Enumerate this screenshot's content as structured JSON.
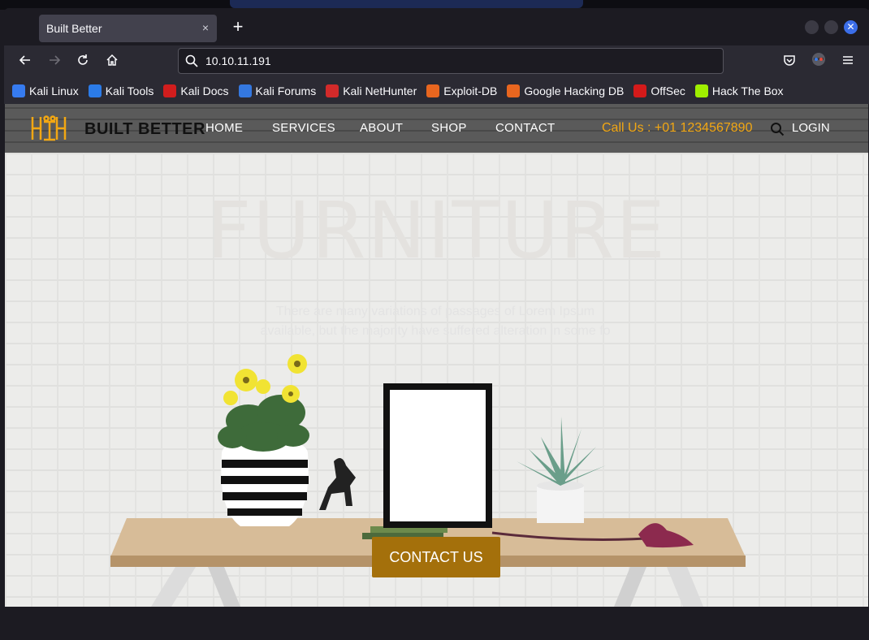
{
  "browser": {
    "tab_title": "Built Better",
    "url": "10.10.11.191",
    "close_tab_glyph": "×",
    "new_tab_glyph": "+"
  },
  "bookmarks": [
    {
      "label": "Kali Linux",
      "icon": "kali-dragon-icon",
      "color": "#367bf0"
    },
    {
      "label": "Kali Tools",
      "icon": "kali-tools-icon",
      "color": "#2b7be8"
    },
    {
      "label": "Kali Docs",
      "icon": "kali-docs-icon",
      "color": "#d11d1d"
    },
    {
      "label": "Kali Forums",
      "icon": "kali-forums-icon",
      "color": "#3478e0"
    },
    {
      "label": "Kali NetHunter",
      "icon": "nethunter-icon",
      "color": "#d22a2a"
    },
    {
      "label": "Exploit-DB",
      "icon": "exploit-db-icon",
      "color": "#e8661f"
    },
    {
      "label": "Google Hacking DB",
      "icon": "ghdb-icon",
      "color": "#e8661f"
    },
    {
      "label": "OffSec",
      "icon": "offsec-icon",
      "color": "#d41a1a"
    },
    {
      "label": "Hack The Box",
      "icon": "htb-icon",
      "color": "#9fef00"
    }
  ],
  "site": {
    "logo_text": "BUILT BETTER",
    "nav": [
      "HOME",
      "SERVICES",
      "ABOUT",
      "SHOP",
      "CONTACT"
    ],
    "phone": "Call Us : +01 1234567890",
    "login": "LOGIN",
    "accent_color": "#f2a713",
    "hero_title": "FURNITURE",
    "hero_text": "There are many variations of passages of Lorem Ipsum available, but the majority have suffered alteration in some fo",
    "cta": "CONTACT US",
    "cta_color": "#a4700b"
  }
}
